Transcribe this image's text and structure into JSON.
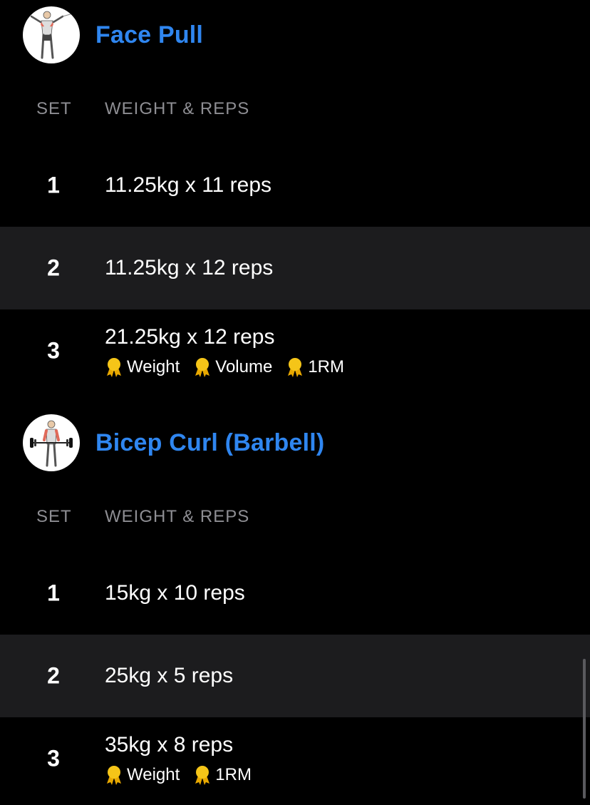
{
  "colors": {
    "accent": "#2f86f0",
    "alt_row": "#1c1c1e",
    "muted": "#8e8e93",
    "medal": "#f5c518"
  },
  "exercises": [
    {
      "title": "Face Pull",
      "image_icon": "face-pull-figure",
      "columns": {
        "set": "SET",
        "weight_reps": "WEIGHT & REPS"
      },
      "sets": [
        {
          "set": "1",
          "weight_reps": "11.25kg x 11 reps",
          "records": []
        },
        {
          "set": "2",
          "weight_reps": "11.25kg x 12 reps",
          "records": []
        },
        {
          "set": "3",
          "weight_reps": "21.25kg x 12 reps",
          "records": [
            "Weight",
            "Volume",
            "1RM"
          ]
        }
      ]
    },
    {
      "title": "Bicep Curl (Barbell)",
      "image_icon": "bicep-curl-figure",
      "columns": {
        "set": "SET",
        "weight_reps": "WEIGHT & REPS"
      },
      "sets": [
        {
          "set": "1",
          "weight_reps": "15kg x 10 reps",
          "records": []
        },
        {
          "set": "2",
          "weight_reps": "25kg x 5 reps",
          "records": []
        },
        {
          "set": "3",
          "weight_reps": "35kg x 8 reps",
          "records": [
            "Weight",
            "1RM"
          ]
        }
      ]
    }
  ]
}
